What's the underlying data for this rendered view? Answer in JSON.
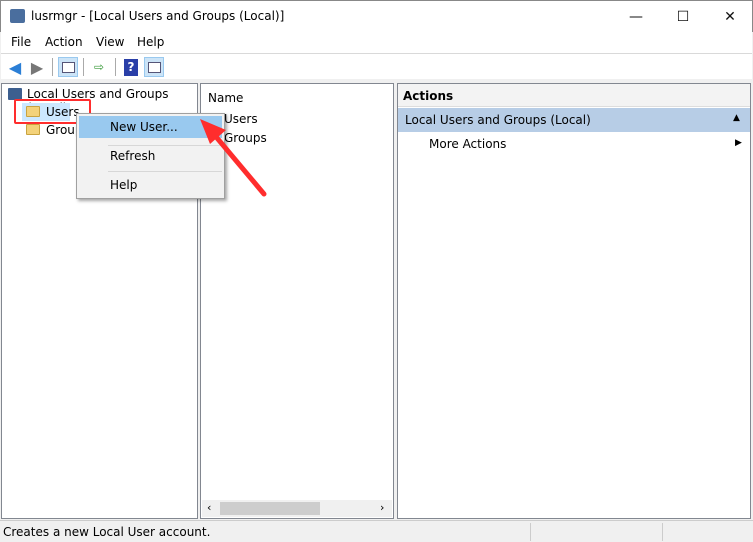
{
  "window": {
    "title": "lusrmgr - [Local Users and Groups (Local)]",
    "minimize": "—",
    "maximize": "☐",
    "close": "✕"
  },
  "menu": [
    "File",
    "Action",
    "View",
    "Help"
  ],
  "tree": {
    "root": "Local Users and Groups (Local)",
    "items": [
      "Users",
      "Groups"
    ]
  },
  "list": {
    "header": "Name",
    "items": [
      "Users",
      "Groups"
    ]
  },
  "actions": {
    "header": "Actions",
    "section": "Local Users and Groups (Local)",
    "more": "More Actions"
  },
  "context_menu": {
    "items": [
      "New User...",
      "Refresh",
      "Help"
    ]
  },
  "status": {
    "text": "Creates a new Local User account."
  },
  "colors": {
    "highlight": "#99c9ef",
    "annotation": "#ff2d2d",
    "actions_section": "#b7cde6"
  }
}
